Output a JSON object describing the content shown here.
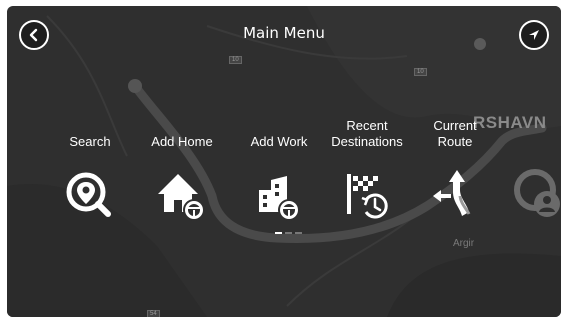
{
  "header": {
    "title": "Main Menu"
  },
  "buttons": {
    "back_icon": "chevron-left-icon",
    "location_icon": "navigation-arrow-icon"
  },
  "map": {
    "place_large": "RSHAVN",
    "place_small": "Argir",
    "road_tags": [
      "10",
      "10",
      "54"
    ]
  },
  "menu": {
    "items": [
      {
        "label": "Search",
        "icon": "search-icon"
      },
      {
        "label": "Add Home",
        "icon": "add-home-icon"
      },
      {
        "label": "Add Work",
        "icon": "add-work-icon"
      },
      {
        "label": "Recent\nDestinations",
        "icon": "recent-destinations-icon"
      },
      {
        "label": "Current\nRoute",
        "icon": "current-route-icon"
      }
    ]
  },
  "pager": {
    "pages": 3,
    "current": 1
  },
  "colors": {
    "background": "#2f2f2f",
    "route": "#4a4a4a",
    "icon": "#ffffff"
  }
}
